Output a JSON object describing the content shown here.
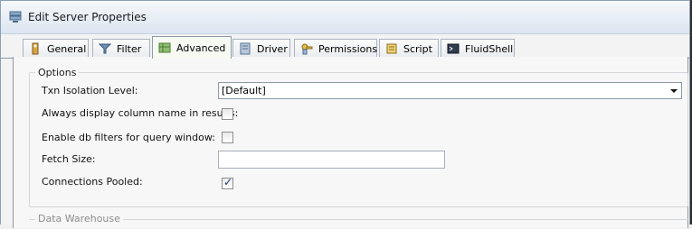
{
  "window": {
    "title": "Edit Server Properties",
    "icon": "server-icon"
  },
  "tabs": [
    {
      "label": "General",
      "icon": "general-icon",
      "active": false
    },
    {
      "label": "Filter",
      "icon": "filter-icon",
      "active": false
    },
    {
      "label": "Advanced",
      "icon": "advanced-icon",
      "active": true
    },
    {
      "label": "Driver",
      "icon": "driver-icon",
      "active": false
    },
    {
      "label": "Permissions",
      "icon": "permissions-icon",
      "active": false
    },
    {
      "label": "Script",
      "icon": "script-icon",
      "active": false
    },
    {
      "label": "FluidShell",
      "icon": "fluidshell-icon",
      "active": false
    }
  ],
  "options": {
    "group_title": "Options",
    "txn_isolation_label": "Txn Isolation Level:",
    "txn_isolation_value": "[Default]",
    "always_display_label": "Always display column name in results:",
    "always_display_checked": false,
    "enable_db_filters_label": "Enable db filters for query window:",
    "enable_db_filters_checked": false,
    "fetch_size_label": "Fetch Size:",
    "fetch_size_value": "",
    "connections_pooled_label": "Connections Pooled:",
    "connections_pooled_checked": true
  },
  "data_warehouse": {
    "group_title": "Data Warehouse"
  }
}
